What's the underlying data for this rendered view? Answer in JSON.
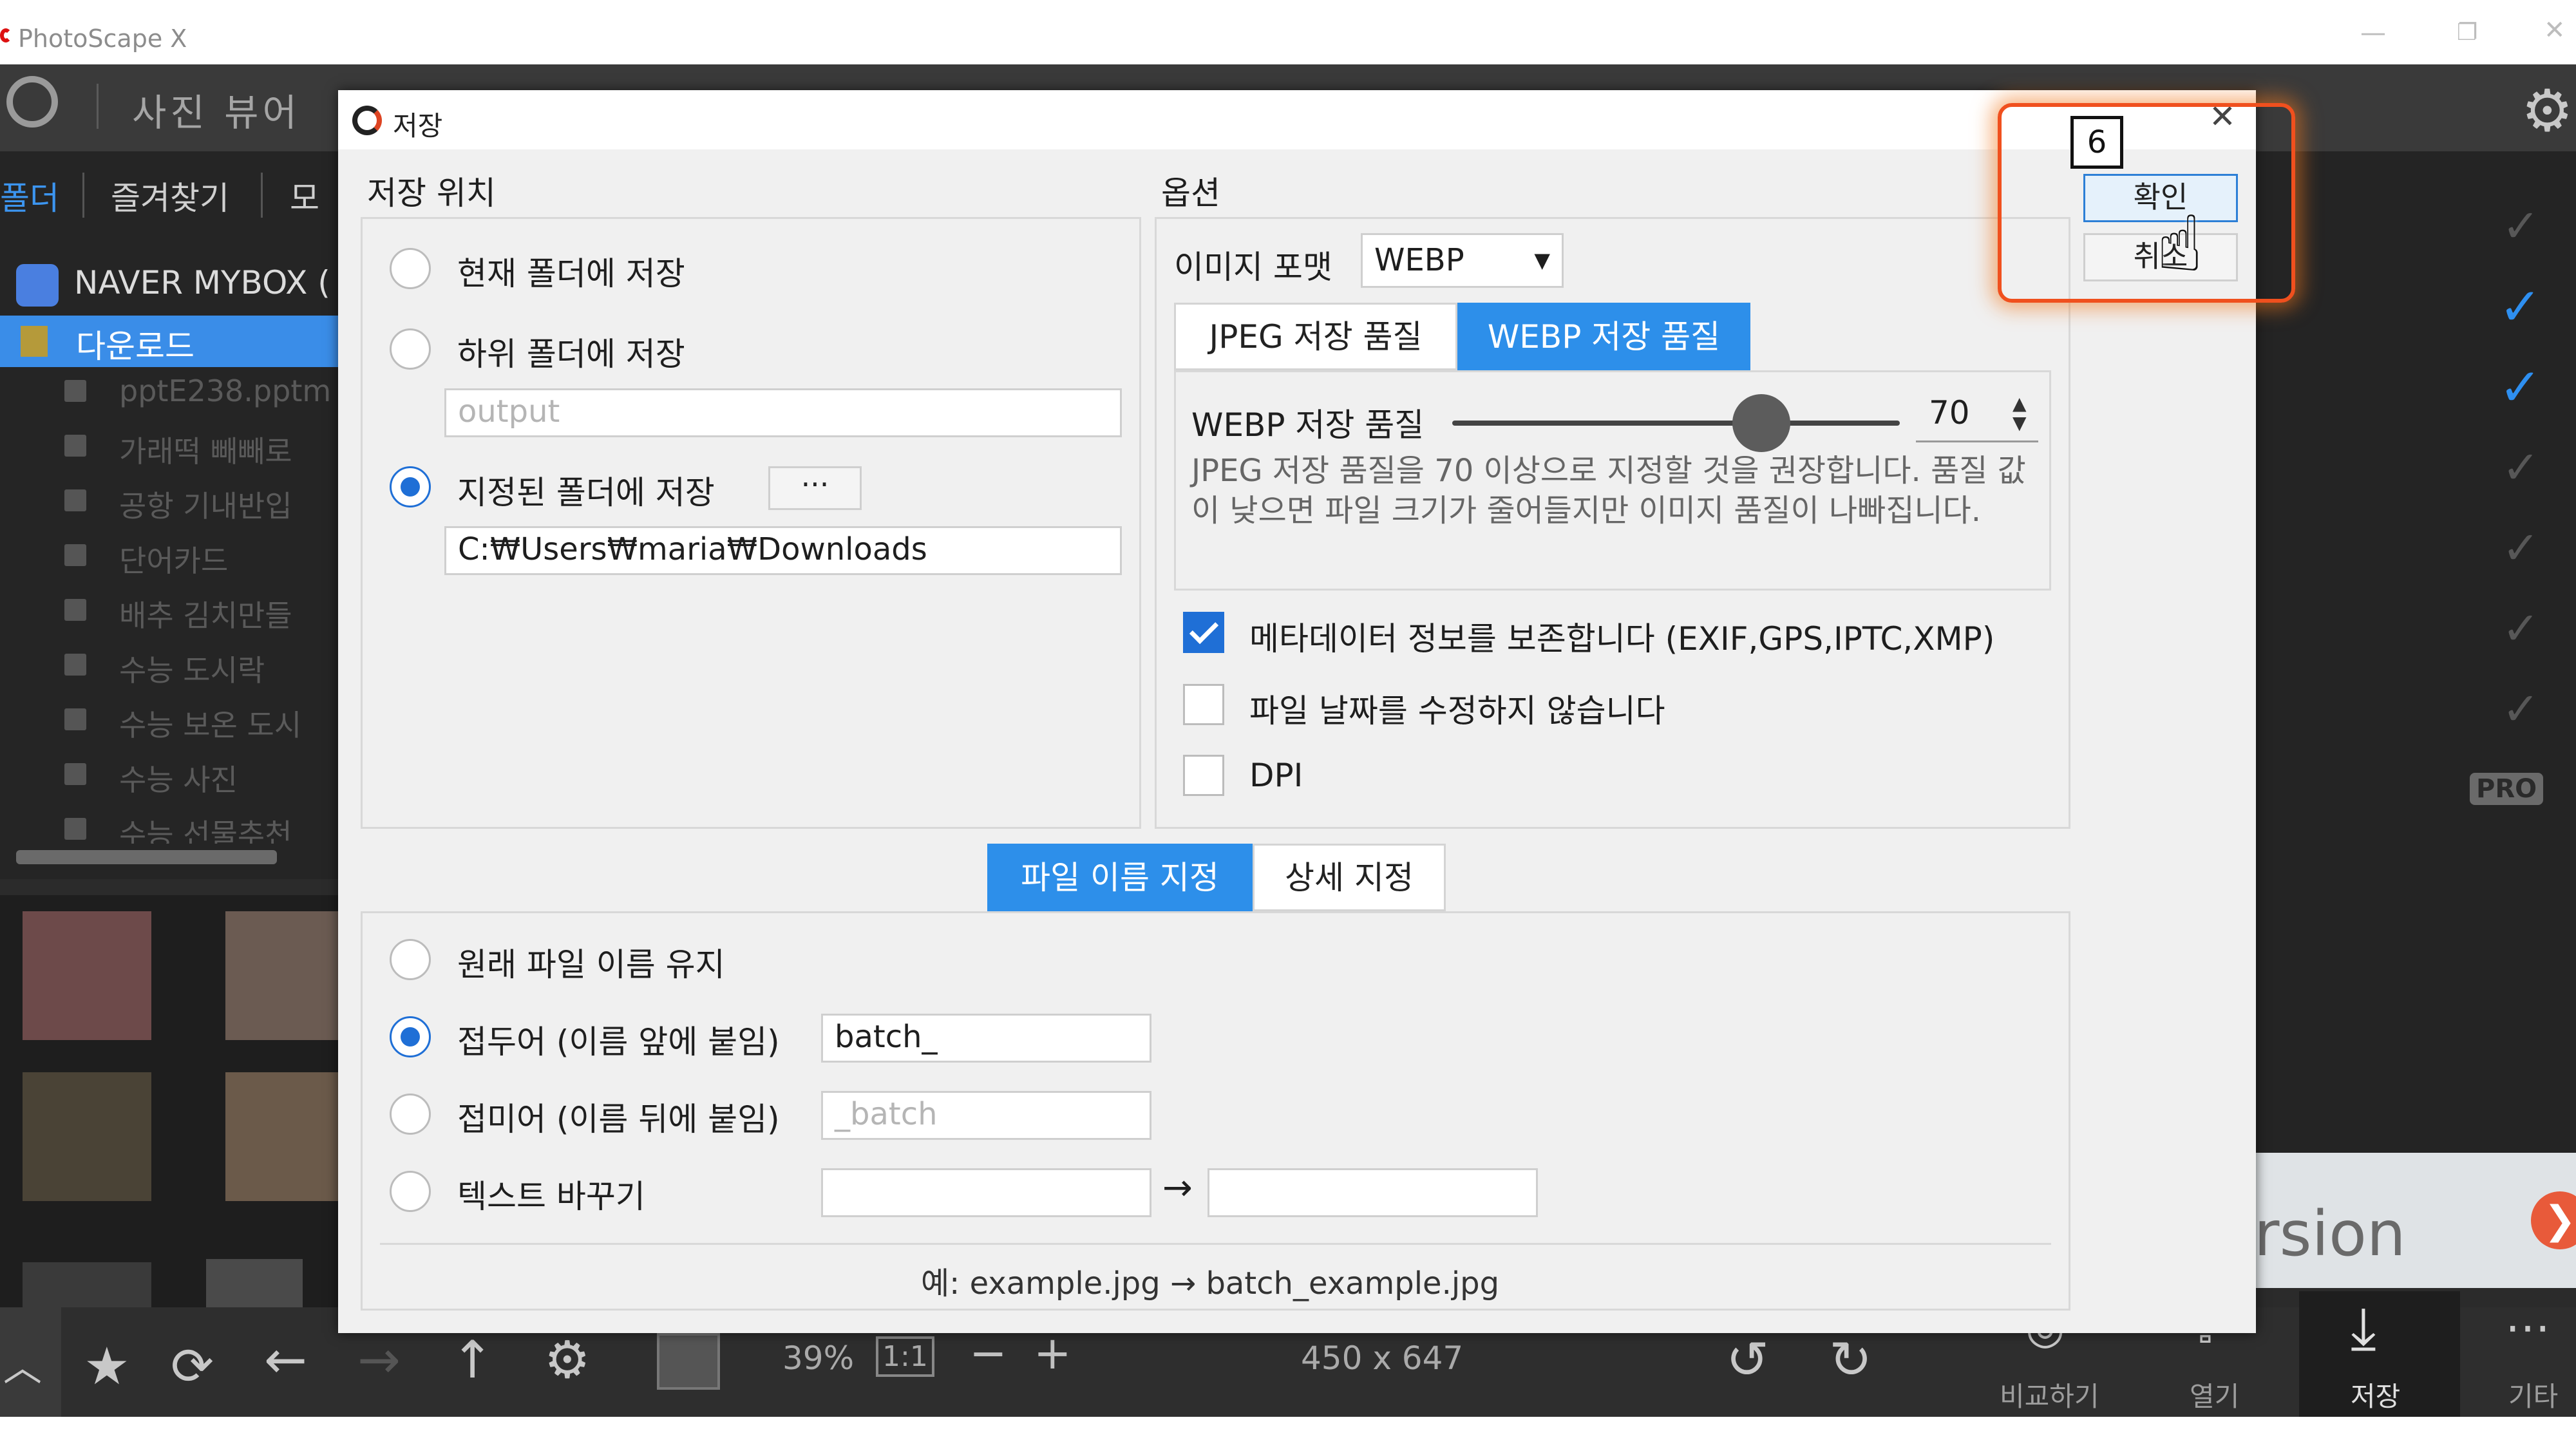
{
  "window": {
    "title": "PhotoScape X"
  },
  "app": {
    "title": "사진 뷰어"
  },
  "left_tabs": [
    "폴더",
    "즐겨찾기",
    "모"
  ],
  "tree": {
    "root": "NAVER MYBOX (",
    "selected": "다운로드",
    "items": [
      "pptE238.pptm",
      "가래떡 빼빼로",
      "공항 기내반입",
      "단어카드",
      "배추 김치만들",
      "수능 도시락",
      "수능 보온 도시",
      "수능 사진",
      "수능 선물추천"
    ]
  },
  "right": {
    "pro_badge": "PRO",
    "banner_text": "rsion"
  },
  "bottom": {
    "zoom": "39%",
    "ratio": "1:1",
    "minus": "−",
    "plus": "+",
    "dimensions": "450 x 647",
    "compare_label": "비교하기",
    "open_label": "열기",
    "save_label": "저장",
    "more_label": "기타"
  },
  "dialog": {
    "title": "저장",
    "location": {
      "heading": "저장 위치",
      "opt_current": "현재 폴더에 저장",
      "opt_sub": "하위 폴더에 저장",
      "sub_placeholder": "output",
      "opt_specified": "지정된 폴더에 저장",
      "browse": "···",
      "path": "C:₩Users₩maria₩Downloads"
    },
    "options": {
      "heading": "옵션",
      "format_label": "이미지 포맷",
      "format_value": "WEBP",
      "tab_jpeg": "JPEG 저장 품질",
      "tab_webp": "WEBP 저장 품질",
      "quality_label": "WEBP 저장 품질",
      "quality_value": "70",
      "quality_fraction": 0.69,
      "note": "JPEG 저장 품질을 70 이상으로 지정할 것을 권장합니다. 품질 값이 낮으면 파일 크기가 줄어들지만 이미지 품질이 나빠집니다.",
      "chk_meta": "메타데이터 정보를 보존합니다 (EXIF,GPS,IPTC,XMP)",
      "chk_date": "파일 날짜를 수정하지 않습니다",
      "chk_dpi": "DPI"
    },
    "naming": {
      "tab_name": "파일 이름 지정",
      "tab_detail": "상세 지정",
      "opt_keep": "원래 파일 이름 유지",
      "opt_prefix": "접두어 (이름 앞에 붙임)",
      "prefix_value": "batch_",
      "opt_suffix": "접미어 (이름 뒤에 붙임)",
      "suffix_placeholder": "_batch",
      "opt_replace": "텍스트 바꾸기",
      "arrow": "→",
      "example": "예: example.jpg → batch_example.jpg"
    },
    "ok": "확인",
    "cancel": "취소",
    "step_badge": "6"
  },
  "colors": {
    "accent": "#2d8fea",
    "highlight": "#f0501e",
    "checked": "#1f6fd6"
  }
}
